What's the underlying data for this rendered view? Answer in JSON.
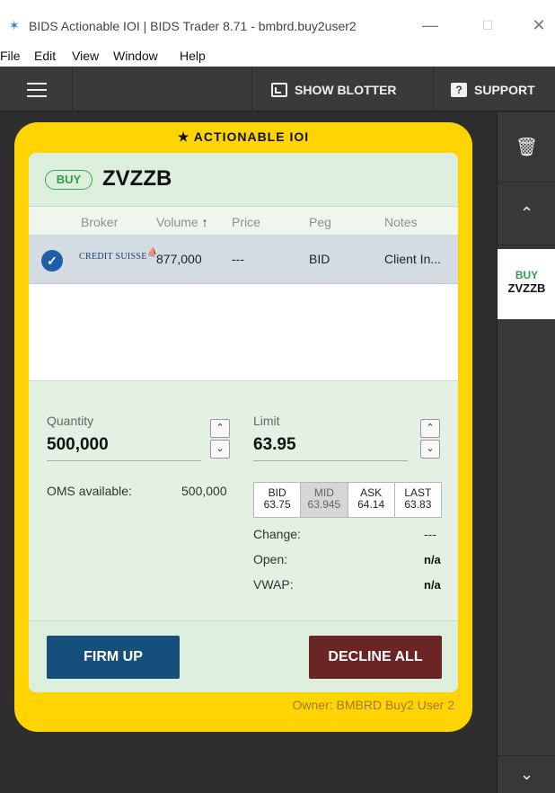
{
  "window": {
    "title": "BIDS Actionable IOI | BIDS Trader 8.71 - bmbrd.buy2user2",
    "minimize": "—",
    "maximize": "☐",
    "close": "✕"
  },
  "menu": [
    "File",
    "Edit",
    "View",
    "Window",
    "Help"
  ],
  "toolbar": {
    "show_blotter": "SHOW BLOTTER",
    "support": "SUPPORT",
    "support_icon_char": "?"
  },
  "ioi": {
    "header": "ACTIONABLE IOI",
    "side": "BUY",
    "symbol": "ZVZZB",
    "columns": {
      "broker": "Broker",
      "volume": "Volume",
      "volume_sort": "↑",
      "price": "Price",
      "peg": "Peg",
      "notes": "Notes"
    },
    "rows": [
      {
        "broker": "CREDIT SUISSE",
        "volume": "877,000",
        "price": "---",
        "peg": "BID",
        "notes": "Client In..."
      }
    ]
  },
  "order": {
    "quantity_label": "Quantity",
    "quantity_value": "500,000",
    "limit_label": "Limit",
    "limit_value": "63.95",
    "oms_label": "OMS available:",
    "oms_value": "500,000",
    "quotes": [
      {
        "name": "BID",
        "value": "63.75"
      },
      {
        "name": "MID",
        "value": "63.945"
      },
      {
        "name": "ASK",
        "value": "64.14"
      },
      {
        "name": "LAST",
        "value": "63.83"
      }
    ],
    "change_label": "Change:",
    "change_value": "---",
    "open_label": "Open:",
    "open_value": "n/a",
    "vwap_label": "VWAP:",
    "vwap_value": "n/a"
  },
  "actions": {
    "firm_up": "FIRM UP",
    "decline_all": "DECLINE ALL"
  },
  "owner": "Owner: BMBRD Buy2 User 2",
  "sidebar": {
    "card_side": "BUY",
    "card_symbol": "ZVZZB"
  },
  "colors": {
    "card_yellow": "#ffd400",
    "buy_green": "#2e9f43",
    "firm_up_blue": "#14507a",
    "decline_red": "#6b2524"
  }
}
